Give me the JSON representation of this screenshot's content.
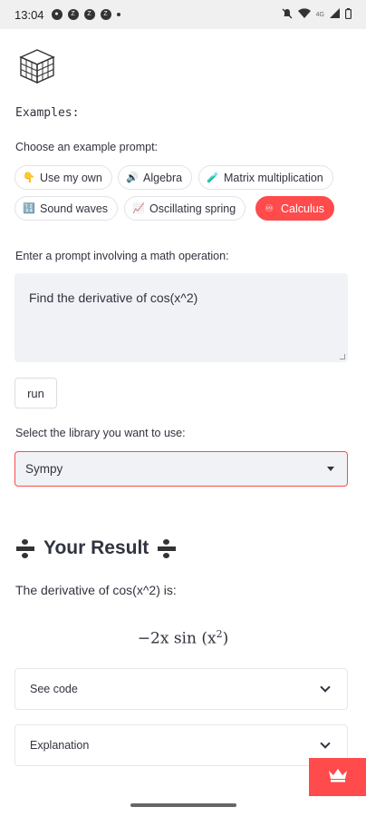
{
  "status_bar": {
    "time": "13:04",
    "left_icons": [
      "chat-icon",
      "z-icon",
      "z-icon",
      "z-icon",
      "dot-icon"
    ],
    "right_icons": [
      "mute-icon",
      "wifi-icon",
      "signal-4g-icon",
      "battery-icon"
    ],
    "network": "4G"
  },
  "app": {
    "logo_icon": "cube-logo-icon",
    "examples_label": "Examples:",
    "choose_label": "Choose an example prompt:",
    "examples": [
      {
        "label": "Use my own",
        "icon": "👇",
        "active": false
      },
      {
        "label": "Algebra",
        "icon": "🔊",
        "active": false
      },
      {
        "label": "Matrix multiplication",
        "icon": "🧪",
        "active": false
      },
      {
        "label": "Sound waves",
        "icon": "🔢",
        "active": false
      },
      {
        "label": "Oscillating spring",
        "icon": "📈",
        "active": false
      },
      {
        "label": "Calculus",
        "icon": "♾",
        "active": true
      }
    ],
    "prompt_label": "Enter a prompt involving a math operation:",
    "prompt_value": "Find the derivative of cos(x^2)",
    "run_label": "run",
    "library_label": "Select the library you want to use:",
    "library_selected": "Sympy",
    "result_title": "Your Result",
    "result_text": "The derivative of cos(x^2) is:",
    "formula": {
      "prefix": "−2x sin (x",
      "exponent": "2",
      "suffix": ")"
    },
    "expanders": [
      {
        "label": "See code"
      },
      {
        "label": "Explanation"
      }
    ]
  },
  "colors": {
    "accent": "#ff4b4b",
    "input_bg": "#f0f2f6",
    "text": "#31333f"
  }
}
